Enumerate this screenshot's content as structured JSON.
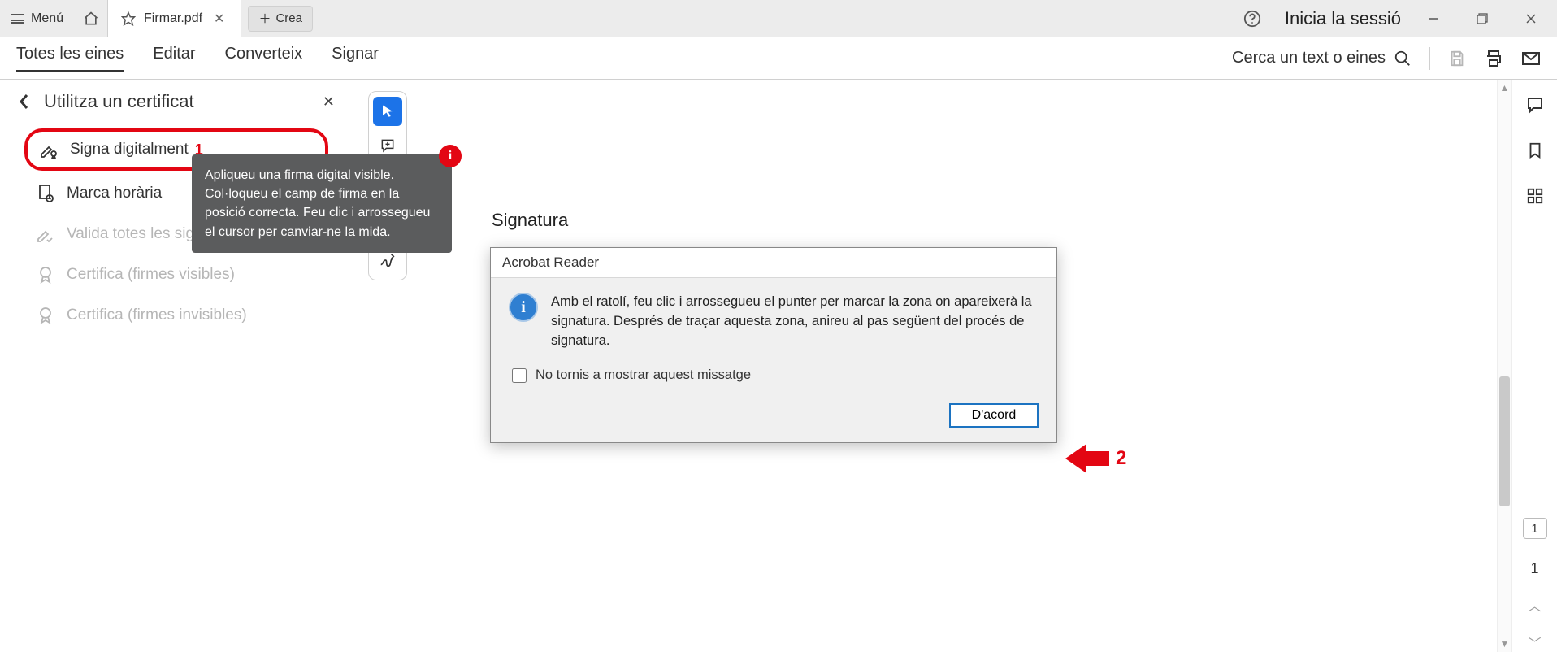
{
  "titlebar": {
    "menu_label": "Menú",
    "tab_label": "Firmar.pdf",
    "create_label": "Crea",
    "signin_label": "Inicia la sessió"
  },
  "toolbar": {
    "items": [
      "Totes les eines",
      "Editar",
      "Converteix",
      "Signar"
    ],
    "active_index": 0,
    "search_placeholder": "Cerca un text o eines"
  },
  "panel": {
    "title": "Utilitza un certificat",
    "items": [
      {
        "label": "Signa digitalment",
        "highlight": true,
        "disabled": false,
        "annotation": "1"
      },
      {
        "label": "Marca horària",
        "highlight": false,
        "disabled": false
      },
      {
        "label": "Valida totes les signatures",
        "highlight": false,
        "disabled": true
      },
      {
        "label": "Certifica (firmes visibles)",
        "highlight": false,
        "disabled": true
      },
      {
        "label": "Certifica (firmes invisibles)",
        "highlight": false,
        "disabled": true
      }
    ]
  },
  "tooltip": {
    "text": "Apliqueu una firma digital visible. Col·loqueu el camp de firma en la posició correcta. Feu clic i arrossegueu el cursor per canviar-ne la mida.",
    "badge": "i"
  },
  "document": {
    "signature_label": "Signatura"
  },
  "dialog": {
    "title": "Acrobat Reader",
    "message": "Amb el ratolí, feu clic i arrossegueu el punter per marcar la zona on apareixerà la signatura. Després de traçar aquesta zona, anireu al pas següent del procés de signatura.",
    "checkbox_label": "No tornis a mostrar aquest missatge",
    "ok_label": "D'acord",
    "annotation": "2"
  },
  "pages": {
    "current": "1",
    "total": "1"
  },
  "icons": {
    "info": "i"
  }
}
